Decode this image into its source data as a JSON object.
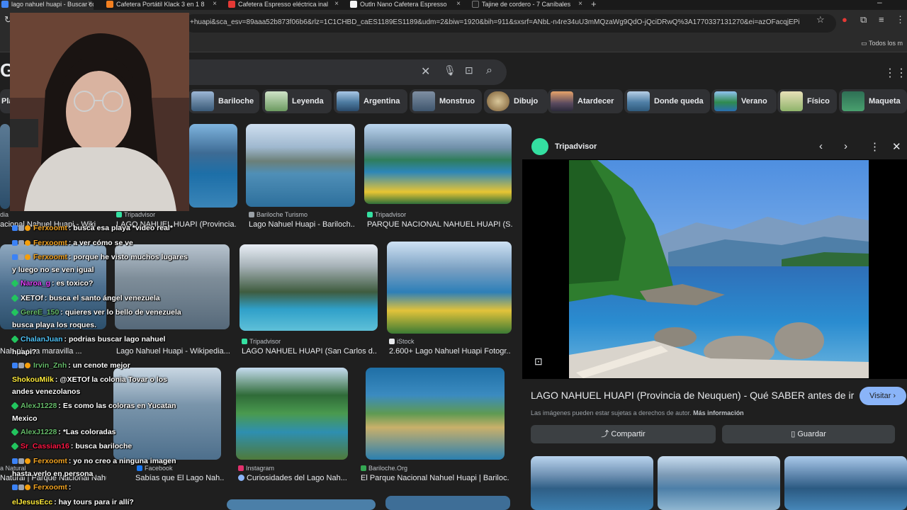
{
  "colors": {
    "accent": "#8ab4f8",
    "page_bg": "#1f1f1f",
    "chip_bg": "#303134"
  },
  "tabs": [
    {
      "title": "lago nahuel huapi - Buscar con",
      "fav": "#4285f4"
    },
    {
      "title": "Cafetera Portátil Klack 3 en 1 8",
      "fav": "#f38020"
    },
    {
      "title": "Cafetera Espresso eléctrica inal",
      "fav": "#e53935"
    },
    {
      "title": "Outln Nano Cafetera Espresso",
      "fav": "#f5f5f5"
    },
    {
      "title": "Tajine de cordero - 7 Caníbales",
      "fav": "#222222"
    }
  ],
  "addressbar": {
    "url": "+huapi&sca_esv=89aaa52b873f06b6&rlz=1C1CHBD_caES1189ES1189&udm=2&biw=1920&bih=911&sxsrf=ANbL-n4re34uU3mMQzaWg9QdO-jQciDRwQ%3A1770337131270&ei=azOFacqjEPitk..."
  },
  "bookmarks": {
    "all": "Todos los m"
  },
  "google": {
    "logo": "G"
  },
  "chips": [
    {
      "label": "Pla"
    },
    {
      "label": "Bariloche"
    },
    {
      "label": "Leyenda"
    },
    {
      "label": "Argentina"
    },
    {
      "label": "Monstruo"
    },
    {
      "label": "Dibujo"
    },
    {
      "label": "Atardecer"
    },
    {
      "label": "Donde queda"
    },
    {
      "label": "Verano"
    },
    {
      "label": "Físico"
    },
    {
      "label": "Maqueta"
    }
  ],
  "results": [
    {
      "source": "dia",
      "caption": "acional Nahuel Huapi - Wiki"
    },
    {
      "source": "Tripadvisor",
      "caption": "LAGO NAHUEL HUAPI (Provincia..."
    },
    {
      "source": "Bariloche Turismo",
      "caption": "Lago Nahuel Huapi - Bariloch..."
    },
    {
      "source": "Tripadvisor",
      "caption": "PARQUE NACIONAL NAHUEL HUAPI (S..."
    },
    {
      "source": "",
      "caption": "Nah",
      "caption2": "pi, una maravilla ..."
    },
    {
      "source": "",
      "caption": "Lago Nahuel Huapi - Wikipedia..."
    },
    {
      "source": "Tripadvisor",
      "caption": "LAGO NAHUEL HUAPI (San Carlos d..."
    },
    {
      "source": "iStock",
      "caption": "2.600+ Lago Nahuel Huapi Fotogr..."
    },
    {
      "source": "a Natural",
      "caption": "Natural | Parque Nacional Nahuel ..."
    },
    {
      "source": "Facebook",
      "caption": "Sabías que El Lago Nah..."
    },
    {
      "source": "Instagram",
      "caption": "Curiosidades del Lago Nah..."
    },
    {
      "source": "Bariloche.Org",
      "caption": "El Parque Nacional Nahuel Huapi | Bariloc..."
    }
  ],
  "panel": {
    "source": "Tripadvisor",
    "title": "LAGO NAHUEL HUAPI (Provincia de Neuquen) - Qué SABER antes de ir",
    "visit": "Visitar",
    "rights": "Las imágenes pueden estar sujetas a derechos de autor.",
    "more_info": "Más información",
    "share": "Compartir",
    "save": "Guardar"
  },
  "chat": [
    {
      "user": "Ferxoomt",
      "color": "#f5a623",
      "text": "busca esa playa *video real*",
      "badges": true
    },
    {
      "user": "Ferxoomt",
      "color": "#f5a623",
      "text": "a ver cómo se ve",
      "badges": true
    },
    {
      "user": "Ferxoomt",
      "color": "#f5a623",
      "text": "porque he visto muchos lugares y luego no se ven igual",
      "badges": true
    },
    {
      "user": "Naroa_g",
      "color": "#e040fb",
      "text": "es toxico?",
      "badges": false
    },
    {
      "user": "XETOf",
      "color": "#ffffff",
      "text": "busca el santo ángel venezuela",
      "badges": false
    },
    {
      "user": "GereE_150",
      "color": "#66bb6a",
      "text": "quieres ver lo bello de venezuela busca playa los roques.",
      "badges": false
    },
    {
      "user": "ChalanJuan",
      "color": "#4fc3f7",
      "text": "podrias buscar lago nahuel huapi?",
      "badges": false
    },
    {
      "user": "Irvin_Znh",
      "color": "#66bb6a",
      "text": "un cenote mejor",
      "badges": true
    },
    {
      "user": "ShokouMilk",
      "color": "#ffeb3b",
      "text": "@XETOf la colonia Tovar o los andes venezolanos",
      "badges": false
    },
    {
      "user": "AlexJ1228",
      "color": "#66bb6a",
      "text": "Es como las coloras en Yucatan Mexico",
      "badges": false
    },
    {
      "user": "AlexJ1228",
      "color": "#66bb6a",
      "text": "*Las coloradas",
      "badges": false
    },
    {
      "user": "Sr_Cassian16",
      "color": "#ff1744",
      "text": "busca bariloche",
      "badges": false
    },
    {
      "user": "Ferxoomt",
      "color": "#f5a623",
      "text": "yo no creo a ninguna imagen hasta verlo en persona",
      "badges": true
    },
    {
      "user": "Ferxoomt",
      "color": "#f5a623",
      "text": "",
      "badges": true
    },
    {
      "user": "elJesusEcc",
      "color": "#ffeb3b",
      "text": "hay tours para ir allí?",
      "badges": false
    }
  ]
}
